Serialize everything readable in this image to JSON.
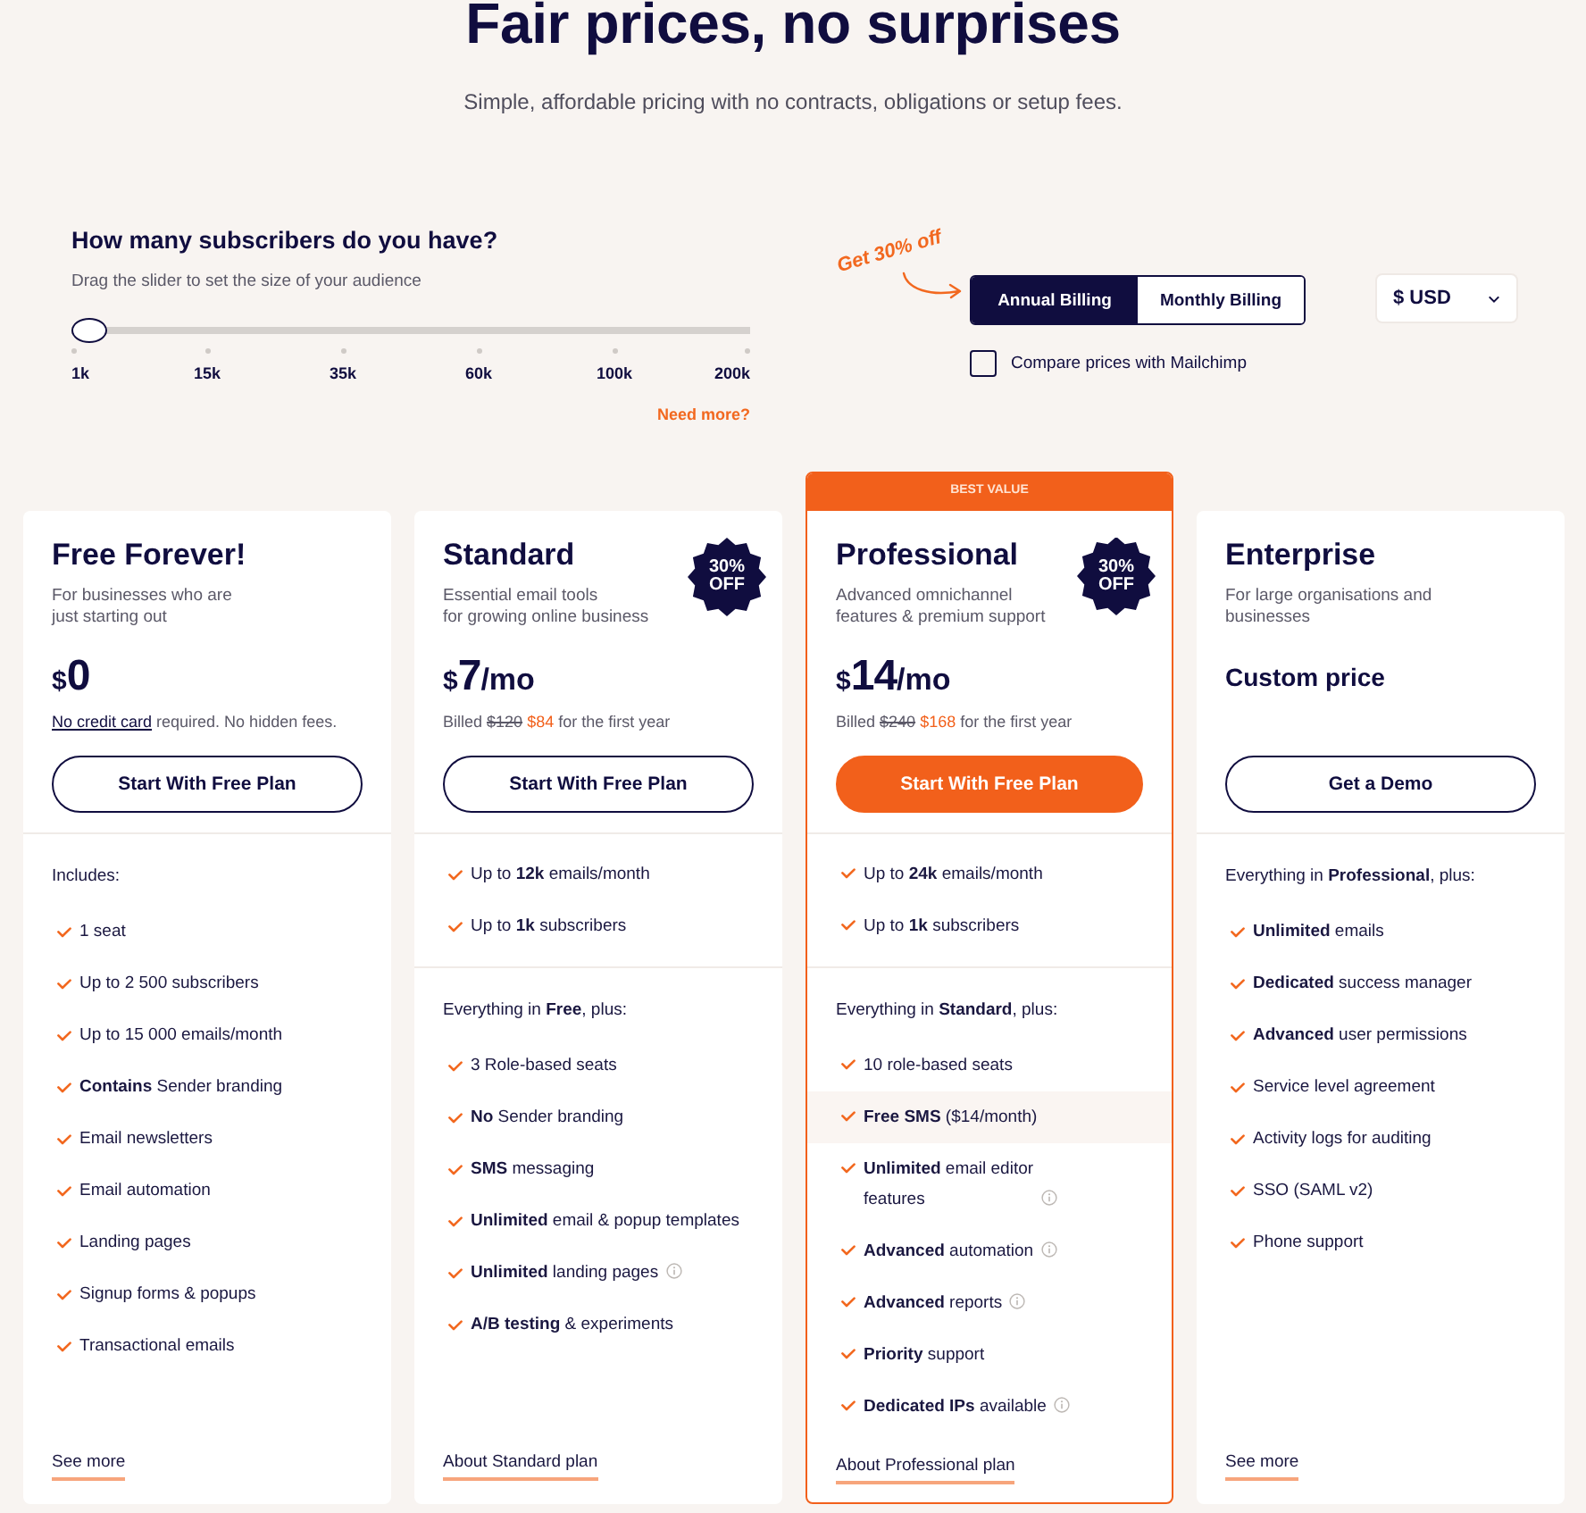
{
  "header": {
    "title": "Fair prices, no surprises",
    "subtitle": "Simple, affordable pricing with no contracts, obligations or setup fees."
  },
  "slider": {
    "title": "How many subscribers do you have?",
    "hint": "Drag the slider to set the size of your audience",
    "level": 0,
    "ticks": [
      "1k",
      "15k",
      "35k",
      "60k",
      "100k",
      "200k"
    ],
    "more_link": "Need more?"
  },
  "promo_note": "Get 30% off",
  "billing": {
    "options": [
      {
        "label": "Annual Billing",
        "selected": true
      },
      {
        "label": "Monthly Billing",
        "selected": false
      }
    ],
    "compare": {
      "label": "Compare prices with Mailchimp",
      "checked": false
    }
  },
  "currency": {
    "value": "$ USD"
  },
  "plans": [
    {
      "name": "Free Forever!",
      "featured": false,
      "description": "For businesses who are\njust starting out",
      "price": {
        "kind": "amount",
        "currency": "$",
        "amount": "0"
      },
      "note": {
        "kind": "link",
        "link": "No credit card",
        "text": "required. No hidden fees."
      },
      "button": "Start With Free Plan",
      "sections": [
        {
          "heading": "Includes:",
          "items": [
            {
              "text": "1 seat",
              "info": false,
              "highlighted": false
            },
            {
              "text": "Up to 2 500 subscribers",
              "info": false,
              "highlighted": false
            },
            {
              "text": "Up to 15 000 emails/month",
              "info": false,
              "highlighted": false
            },
            {
              "text": "**Contains** Sender branding",
              "info": false,
              "highlighted": false
            },
            {
              "text": "Email newsletters",
              "info": false,
              "highlighted": false
            },
            {
              "text": "Email automation",
              "info": false,
              "highlighted": false
            },
            {
              "text": "Landing pages",
              "info": false,
              "highlighted": false
            },
            {
              "text": "Signup forms & popups",
              "info": false,
              "highlighted": false
            },
            {
              "text": "Transactional emails",
              "info": false,
              "highlighted": false
            }
          ]
        }
      ],
      "link": "See more"
    },
    {
      "name": "Standard",
      "featured": false,
      "badge": "30% OFF",
      "description": "Essential email tools\nfor growing online business",
      "price": {
        "kind": "amount",
        "currency": "$",
        "amount": "7",
        "period": "/mo"
      },
      "note": {
        "kind": "billing",
        "prefix": "Billed",
        "old": "$120",
        "new": "$84",
        "suffix": "for the first year"
      },
      "button": "Start With Free Plan",
      "sections": [
        {
          "items": [
            {
              "text": "Up to **12k** emails/month",
              "info": false,
              "highlighted": false
            },
            {
              "text": "Up to **1k** subscribers",
              "info": false,
              "highlighted": false
            }
          ]
        },
        {
          "heading": "Everything in **Free**, plus:",
          "items": [
            {
              "text": "3 Role-based seats",
              "info": false,
              "highlighted": false
            },
            {
              "text": "**No** Sender branding",
              "info": false,
              "highlighted": false
            },
            {
              "text": "**SMS** messaging",
              "info": false,
              "highlighted": false
            },
            {
              "text": "**Unlimited** email & popup templates",
              "info": false,
              "highlighted": false
            },
            {
              "text": "**Unlimited** landing pages",
              "info": true,
              "highlighted": false
            },
            {
              "text": "**A/B testing** & experiments",
              "info": false,
              "highlighted": false
            }
          ]
        }
      ],
      "link": "About Standard plan"
    },
    {
      "name": "Professional",
      "featured": true,
      "ribbon": "BEST VALUE",
      "badge": "30% OFF",
      "description": "Advanced omnichannel\nfeatures & premium support",
      "price": {
        "kind": "amount",
        "currency": "$",
        "amount": "14",
        "period": "/mo"
      },
      "note": {
        "kind": "billing",
        "prefix": "Billed",
        "old": "$240",
        "new": "$168",
        "suffix": "for the first year"
      },
      "button": "Start With Free Plan",
      "sections": [
        {
          "items": [
            {
              "text": "Up to **24k** emails/month",
              "info": false,
              "highlighted": false
            },
            {
              "text": "Up to **1k** subscribers",
              "info": false,
              "highlighted": false
            }
          ]
        },
        {
          "heading": "Everything in **Standard**, plus:",
          "items": [
            {
              "text": "10 role-based seats",
              "info": false,
              "highlighted": false
            },
            {
              "text": "**Free SMS** ($14/month)",
              "info": false,
              "highlighted": true
            },
            {
              "text": "**Unlimited** email editor\nfeatures",
              "info": true,
              "highlighted": false
            },
            {
              "text": "**Advanced** automation",
              "info": true,
              "highlighted": false
            },
            {
              "text": "**Advanced** reports",
              "info": true,
              "highlighted": false
            },
            {
              "text": "**Priority** support",
              "info": false,
              "highlighted": false
            },
            {
              "text": "**Dedicated IPs** available",
              "info": true,
              "highlighted": false
            }
          ]
        }
      ],
      "link": "About Professional plan"
    },
    {
      "name": "Enterprise",
      "featured": false,
      "description": "For large organisations and\nbusinesses",
      "price": {
        "kind": "custom",
        "text": "Custom price"
      },
      "button": "Get a Demo",
      "sections": [
        {
          "heading": "Everything in **Professional**, plus:",
          "items": [
            {
              "text": "**Unlimited** emails",
              "info": false,
              "highlighted": false
            },
            {
              "text": "**Dedicated** success manager",
              "info": false,
              "highlighted": false
            },
            {
              "text": "**Advanced** user permissions",
              "info": false,
              "highlighted": false
            },
            {
              "text": "Service level agreement",
              "info": false,
              "highlighted": false
            },
            {
              "text": "Activity logs for auditing",
              "info": false,
              "highlighted": false
            },
            {
              "text": "SSO (SAML v2)",
              "info": false,
              "highlighted": false
            },
            {
              "text": "Phone support",
              "info": false,
              "highlighted": false
            }
          ]
        }
      ],
      "link": "See more"
    }
  ]
}
